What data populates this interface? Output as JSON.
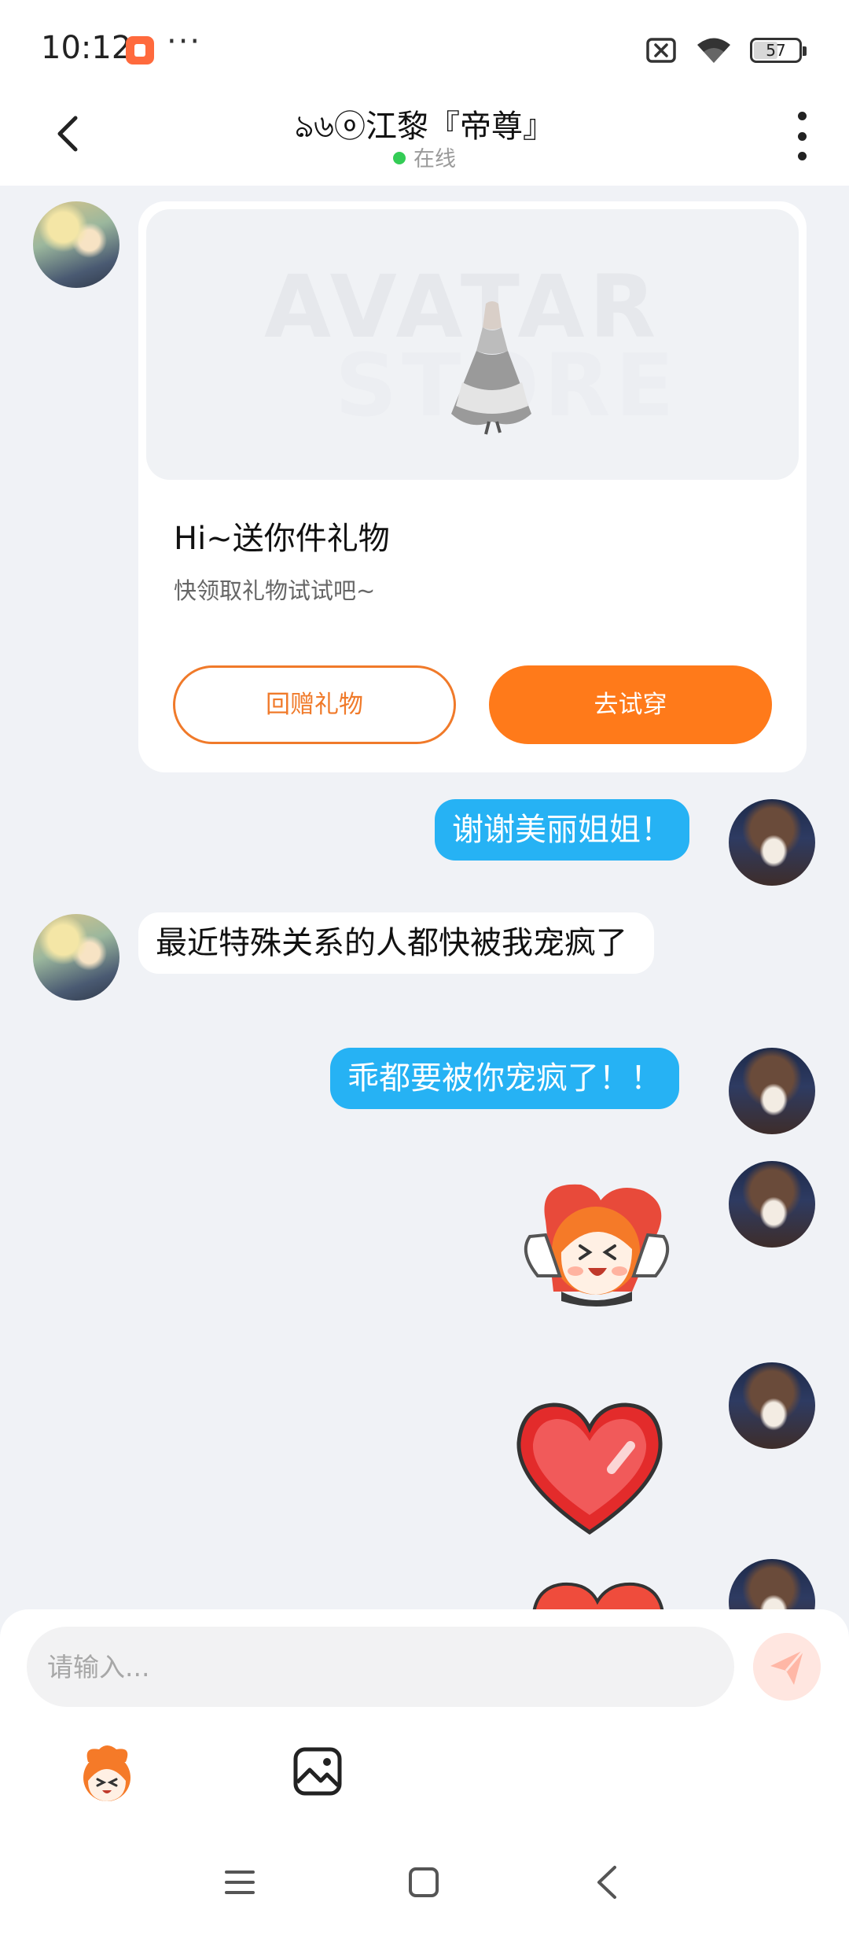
{
  "status_bar": {
    "time": "10:12",
    "dots": "···",
    "battery": "57",
    "battery_level": 0.57,
    "icons": [
      "app-notification-icon",
      "close-box-icon",
      "wifi-icon",
      "battery-icon"
    ]
  },
  "header": {
    "title": "ঌ৬ⓞ江黎『帝尊』",
    "status": "在线",
    "status_color": "#33cc55",
    "icons": [
      "back-arrow-icon",
      "more-vertical-icon"
    ]
  },
  "messages": {
    "gift_card": {
      "title": "Hi~送你件礼物",
      "subtitle": "快领取礼物试试吧~",
      "banner_line1": "AVATAR",
      "banner_line2": "STORE",
      "return_button": "回赠礼物",
      "try_button": "去试穿"
    },
    "msg1": "谢谢美丽姐姐！",
    "msg2": "最近特殊关系的人都快被我宠疯了",
    "msg3": "乖都要被你宠疯了！！",
    "stickers": [
      "hug-character-sticker",
      "red-heart-sticker",
      "red-heart-sticker"
    ]
  },
  "input": {
    "placeholder": "请输入...",
    "icons": [
      "send-icon",
      "emoji-sticker-icon",
      "image-icon"
    ]
  },
  "navbar": {
    "icons": [
      "menu-icon",
      "home-icon",
      "back-icon"
    ]
  },
  "colors": {
    "accent_orange": "#ff7a1a",
    "outgoing_bubble": "#26b2f4",
    "background": "#f0f2f6"
  }
}
